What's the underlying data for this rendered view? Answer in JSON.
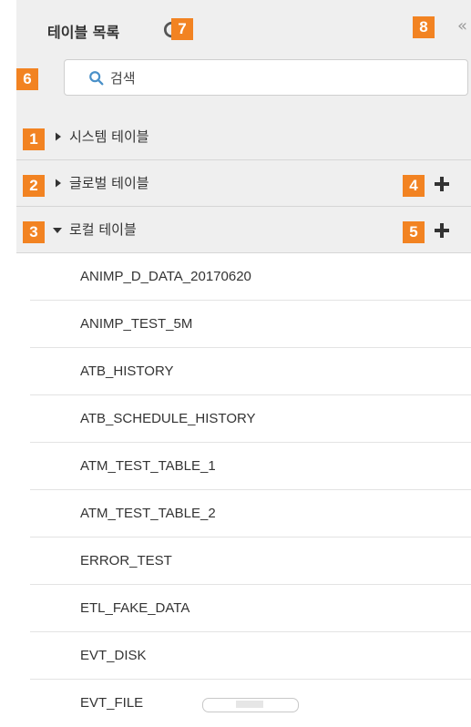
{
  "panel": {
    "title": "테이블 목록",
    "search": {
      "placeholder": "검색",
      "value": ""
    },
    "sections": [
      {
        "label": "시스템 테이블",
        "badge": "1",
        "expanded": false
      },
      {
        "label": "글로벌 테이블",
        "badge": "2",
        "expanded": false,
        "add_badge": "4"
      },
      {
        "label": "로컬 테이블",
        "badge": "3",
        "expanded": true,
        "add_badge": "5"
      }
    ],
    "badges": {
      "search": "6",
      "refresh": "7",
      "collapse": "8"
    },
    "local_tables": [
      "ANIMP_D_DATA_20170620",
      "ANIMP_TEST_5M",
      "ATB_HISTORY",
      "ATB_SCHEDULE_HISTORY",
      "ATM_TEST_TABLE_1",
      "ATM_TEST_TABLE_2",
      "ERROR_TEST",
      "ETL_FAKE_DATA",
      "EVT_DISK",
      "EVT_FILE"
    ]
  },
  "icons": {
    "refresh": "refresh-icon",
    "collapse": "double-chevron-left-icon",
    "search": "search-icon",
    "add": "plus-icon",
    "collapsed_arrow": "triangle-right-icon",
    "expanded_arrow": "triangle-down-icon"
  },
  "colors": {
    "badge": "#f28322",
    "search_icon": "#4a90c8",
    "header_bg": "#efefef"
  }
}
